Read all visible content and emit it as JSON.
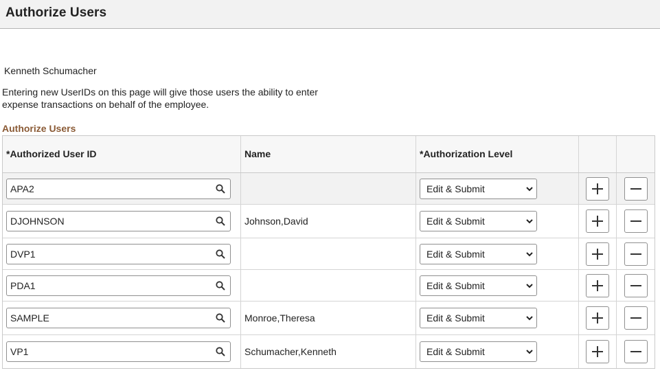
{
  "header": {
    "title": "Authorize Users"
  },
  "employee_name": "Kenneth Schumacher",
  "instructions": "Entering new UserIDs on this page will give those users the ability to enter expense transactions on behalf of the employee.",
  "grid": {
    "title": "Authorize Users",
    "columns": {
      "user_id": "*Authorized User ID",
      "name": "Name",
      "level": "*Authorization Level"
    },
    "rows": [
      {
        "user_id": "APA2",
        "name": "",
        "level": "Edit & Submit"
      },
      {
        "user_id": "DJOHNSON",
        "name": "Johnson,David",
        "level": "Edit & Submit"
      },
      {
        "user_id": "DVP1",
        "name": "",
        "level": "Edit & Submit"
      },
      {
        "user_id": "PDA1",
        "name": "",
        "level": "Edit & Submit"
      },
      {
        "user_id": "SAMPLE",
        "name": "Monroe,Theresa",
        "level": "Edit & Submit"
      },
      {
        "user_id": "VP1",
        "name": "Schumacher,Kenneth",
        "level": "Edit & Submit"
      }
    ]
  },
  "icons": {
    "lookup": "search-icon",
    "level_dropdown": "chevron-down-icon",
    "add": "plus-icon",
    "delete": "minus-icon"
  },
  "colors": {
    "grid_title": "#8a5a35",
    "header_bg": "#f2f2f2"
  }
}
